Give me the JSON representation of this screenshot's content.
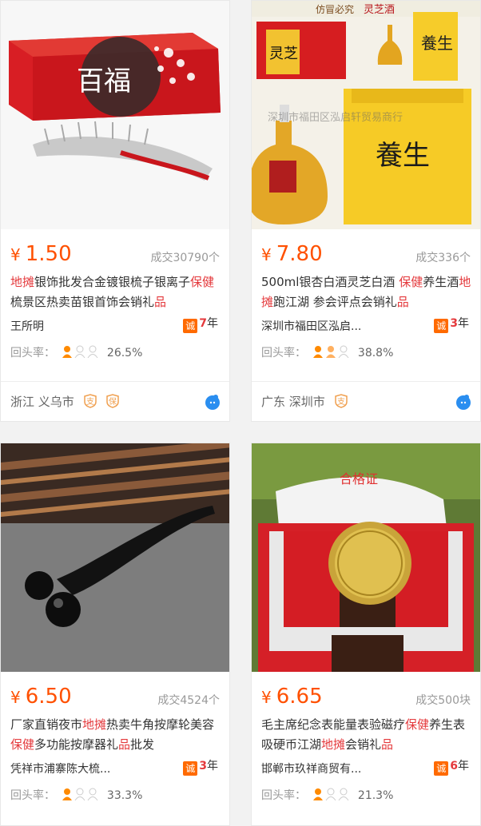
{
  "products": [
    {
      "price": "1.50",
      "currency": "¥",
      "deals": "成交30790个",
      "title_parts": [
        {
          "text": "地摊",
          "hl": true
        },
        {
          "text": "银饰批发合金镀银梳子银离子",
          "hl": false
        },
        {
          "text": "保健",
          "hl": true
        },
        {
          "text": "梳景区热卖苗银首饰会销礼",
          "hl": false
        },
        {
          "text": "品",
          "hl": true
        }
      ],
      "shop": "王所明",
      "cheng_badge": "诚",
      "years_num": "7",
      "years_unit": "年",
      "repeat_label": "回头率：",
      "repeat_rate": "26.5%",
      "repeat_level": 1,
      "location": "浙江 义乌市",
      "tags": [
        "支",
        "保"
      ],
      "image": "comb-box"
    },
    {
      "price": "7.80",
      "currency": "¥",
      "deals": "成交336个",
      "title_parts": [
        {
          "text": "500ml银杏白酒灵芝白酒 ",
          "hl": false
        },
        {
          "text": "保健",
          "hl": true
        },
        {
          "text": "养生酒",
          "hl": false
        },
        {
          "text": "地摊",
          "hl": true
        },
        {
          "text": "跑江湖 参会评点会销礼",
          "hl": false
        },
        {
          "text": "品",
          "hl": true
        }
      ],
      "shop": "深圳市福田区泓启...",
      "cheng_badge": "诚",
      "years_num": "3",
      "years_unit": "年",
      "repeat_label": "回头率：",
      "repeat_rate": "38.8%",
      "repeat_level": 1.5,
      "location": "广东 深圳市",
      "tags": [
        "支"
      ],
      "image": "liquor",
      "image_texts": {
        "brand": "仿冒必究",
        "wine": "灵芝酒",
        "left_box": "灵芝",
        "right_box": "養生",
        "watermark": "深圳市福田区泓启轩贸易商行"
      }
    },
    {
      "price": "6.50",
      "currency": "¥",
      "deals": "成交4524个",
      "title_parts": [
        {
          "text": "厂家直销夜市",
          "hl": false
        },
        {
          "text": "地摊",
          "hl": true
        },
        {
          "text": "热卖牛角按摩轮美容",
          "hl": false
        },
        {
          "text": "保健",
          "hl": true
        },
        {
          "text": "多功能按摩器礼",
          "hl": false
        },
        {
          "text": "品",
          "hl": true
        },
        {
          "text": "批发",
          "hl": false
        }
      ],
      "shop": "凭祥市浦寨陈大梳...",
      "cheng_badge": "诚",
      "years_num": "3",
      "years_unit": "年",
      "repeat_label": "回头率：",
      "repeat_rate": "33.3%",
      "repeat_level": 1,
      "image": "horn-roller"
    },
    {
      "price": "6.65",
      "currency": "¥",
      "deals": "成交500块",
      "title_parts": [
        {
          "text": "毛主席纪念表能量表验磁疗",
          "hl": false
        },
        {
          "text": "保健",
          "hl": true
        },
        {
          "text": "养生表吸硬币江湖",
          "hl": false
        },
        {
          "text": "地摊",
          "hl": true
        },
        {
          "text": "会销礼",
          "hl": false
        },
        {
          "text": "品",
          "hl": true
        }
      ],
      "shop": "邯郸市玖祥商贸有...",
      "cheng_badge": "诚",
      "years_num": "6",
      "years_unit": "年",
      "repeat_label": "回头率：",
      "repeat_rate": "21.3%",
      "repeat_level": 1,
      "image": "watch",
      "image_texts": {
        "certificate": "合格证"
      }
    }
  ],
  "colors": {
    "price": "#ff5000",
    "highlight": "#e4393c",
    "badge": "#ff6a00",
    "tag": "#f0a050",
    "wangwang": "#2a8ef0"
  }
}
